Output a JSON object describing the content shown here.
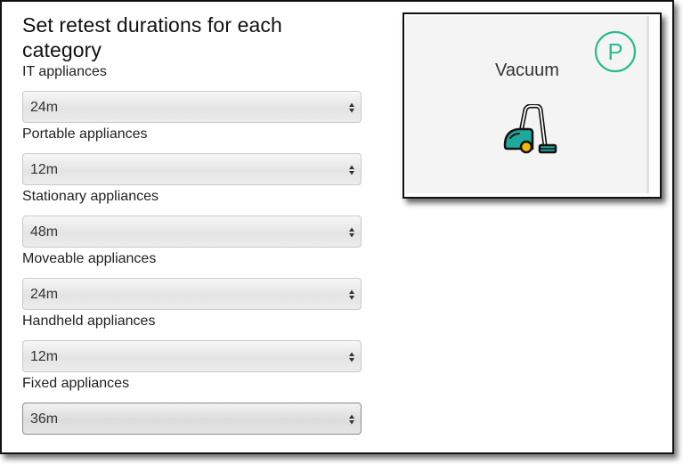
{
  "heading": "Set retest durations for each category",
  "categories": [
    {
      "label": "IT appliances",
      "value": "24m"
    },
    {
      "label": "Portable appliances",
      "value": "12m"
    },
    {
      "label": "Stationary appliances",
      "value": "48m"
    },
    {
      "label": "Moveable appliances",
      "value": "24m"
    },
    {
      "label": "Handheld appliances",
      "value": "12m"
    },
    {
      "label": "Fixed appliances",
      "value": "36m"
    }
  ],
  "card": {
    "title": "Vacuum",
    "badge_letter": "P",
    "icon": "vacuum-cleaner-icon",
    "badge_color": "#2dbb8f",
    "icon_body_color": "#1fa99a",
    "icon_wheel_color": "#f5b800"
  }
}
